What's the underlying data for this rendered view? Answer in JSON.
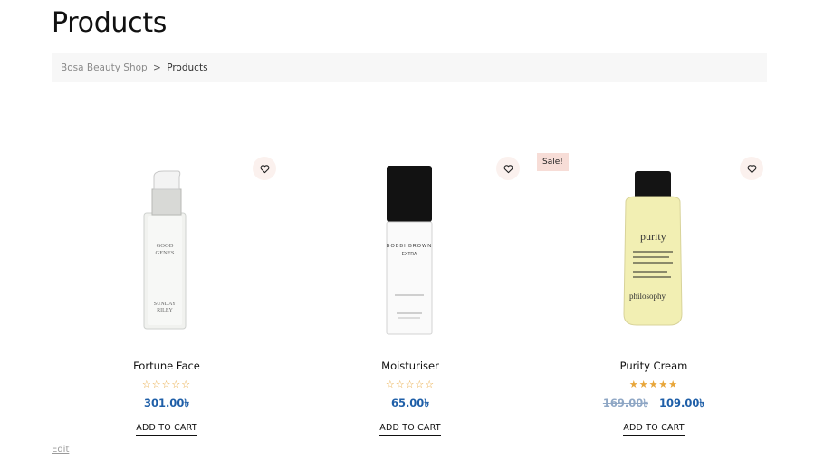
{
  "page": {
    "title": "Products"
  },
  "breadcrumb": {
    "home": "Bosa Beauty Shop",
    "separator": ">",
    "current": "Products"
  },
  "products": [
    {
      "name": "Fortune Face",
      "rating": 0,
      "stars_empty": "☆☆☆☆☆",
      "price": "301.00৳",
      "add_to_cart": "ADD TO CART",
      "wishlist_icon": "heart-icon"
    },
    {
      "name": "Moisturiser",
      "rating": 0,
      "stars_empty": "☆☆☆☆☆",
      "price": "65.00৳",
      "add_to_cart": "ADD TO CART",
      "wishlist_icon": "heart-icon"
    },
    {
      "name": "Purity Cream",
      "rating": 5,
      "stars_full": "★★★★★",
      "sale_badge": "Sale!",
      "old_price": "169.00৳",
      "price": "109.00৳",
      "add_to_cart": "ADD TO CART",
      "wishlist_icon": "heart-icon"
    }
  ],
  "bottle_labels": {
    "p1": [
      "GOOD",
      "GENES",
      "SUNDAY",
      "RILEY"
    ],
    "p2": [
      "BOBBI BROWN",
      "EXTRA"
    ],
    "p3": [
      "purity",
      "philosophy"
    ]
  },
  "footer": {
    "edit": "Edit"
  },
  "colors": {
    "accent_price": "#1f5fa8",
    "star": "#e8a63a",
    "sale_badge_bg": "#f7ddd7",
    "breadcrumb_bg": "#f7f7f7"
  }
}
